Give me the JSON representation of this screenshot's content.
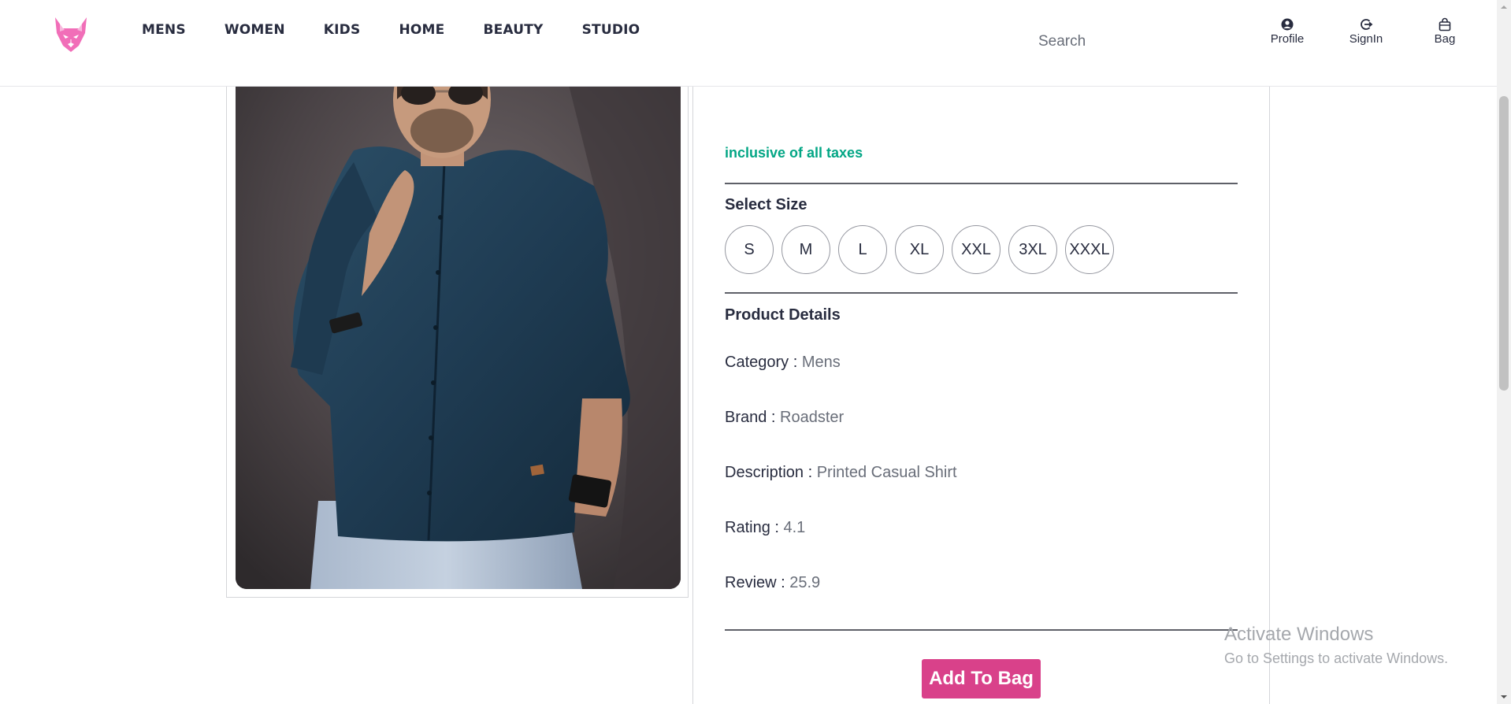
{
  "header": {
    "nav": [
      "MENS",
      "WOMEN",
      "KIDS",
      "HOME",
      "BEAUTY",
      "STUDIO"
    ],
    "search_placeholder": "Search",
    "actions": {
      "profile": "Profile",
      "signin": "SignIn",
      "bag": "Bag"
    },
    "brand_color": "#f16eb8"
  },
  "product": {
    "taxes_note": "inclusive of all taxes",
    "select_size_title": "Select Size",
    "sizes": [
      "S",
      "M",
      "L",
      "XL",
      "XXL",
      "3XL",
      "XXXL"
    ],
    "details_title": "Product Details",
    "details": {
      "category_label": "Category : ",
      "category": "Mens",
      "brand_label": "Brand : ",
      "brand": "Roadster",
      "description_label": "Description : ",
      "description": "Printed Casual Shirt",
      "rating_label": "Rating : ",
      "rating": "4.1",
      "review_label": "Review : ",
      "review": "25.9"
    },
    "add_to_bag": "Add To Bag",
    "accent_color": "#d9418a",
    "taxes_color": "#03a685"
  },
  "watermark": {
    "title": "Activate Windows",
    "subtitle": "Go to Settings to activate Windows."
  }
}
